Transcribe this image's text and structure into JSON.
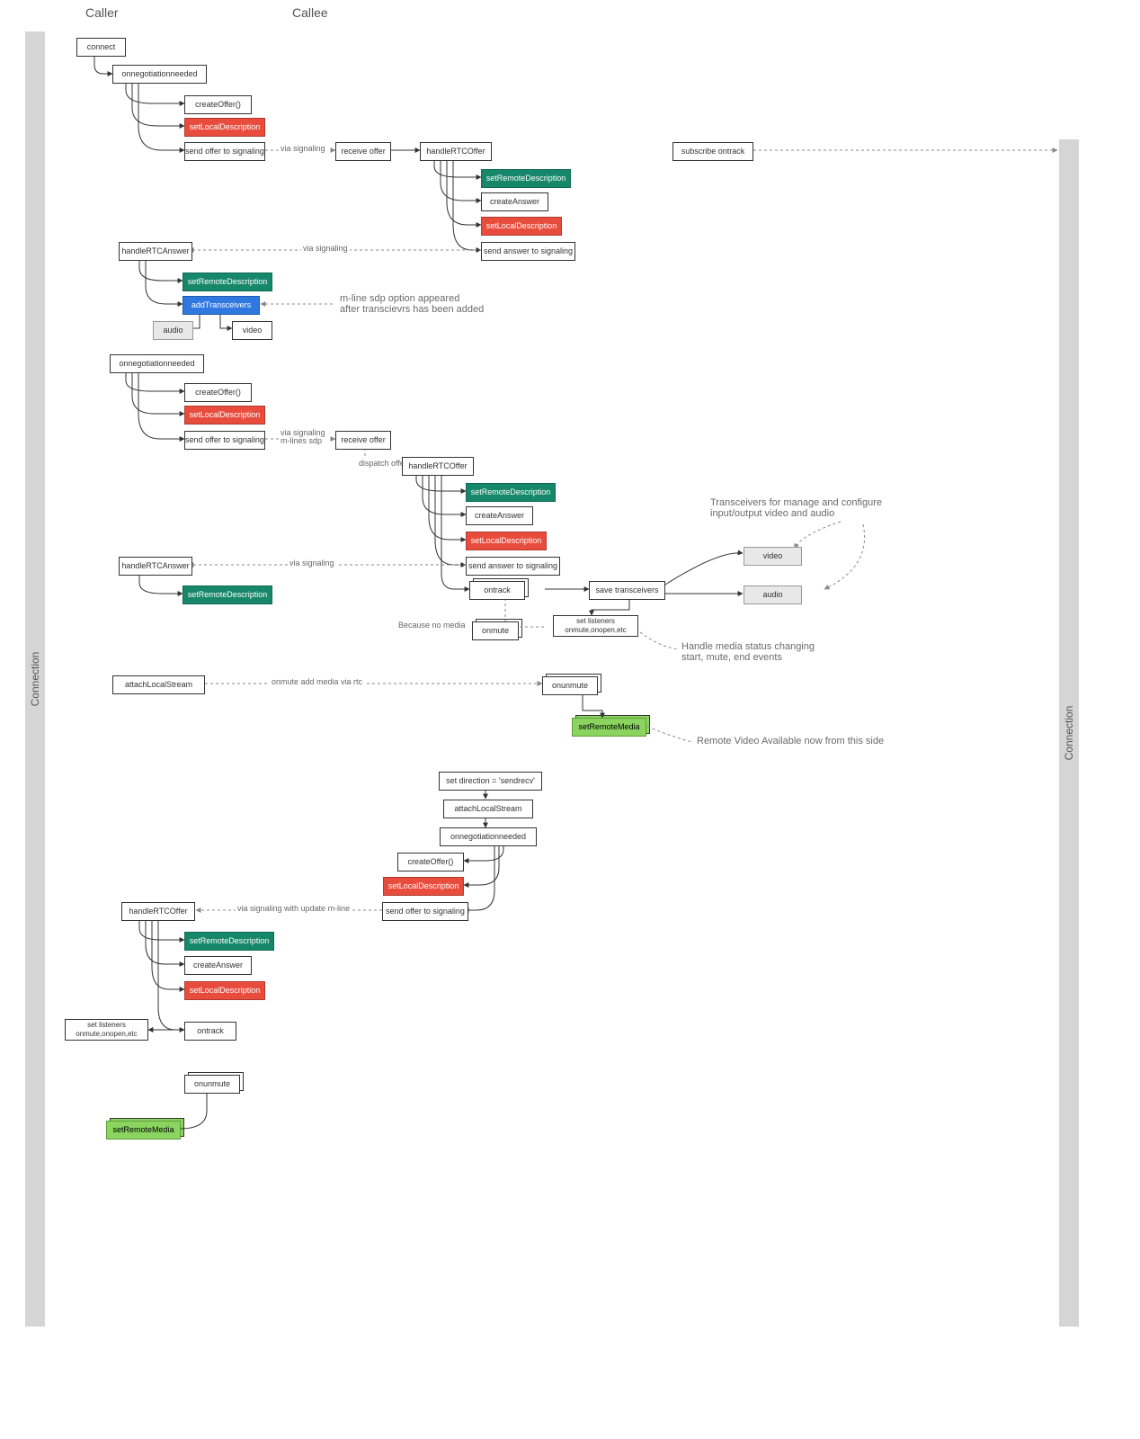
{
  "headers": {
    "caller": "Caller",
    "callee": "Callee"
  },
  "lanes": {
    "left": "Connection",
    "right": "Connection"
  },
  "nodes": {
    "connect": "connect",
    "onneg1": "onnegotiationneeded",
    "createOffer1": "createOffer()",
    "setLocal1": "setLocalDescription",
    "sendOffer1": "send offer to signaling",
    "recvOffer1": "receive offer",
    "handleOffer1": "handleRTCOffer",
    "subscribe": "subscribe ontrack",
    "setRemote1": "setRemoteDescription",
    "createAnswer1": "createAnswer",
    "setLocal2": "setLocalDescription",
    "sendAnswer1": "send answer to signaling",
    "handleAnswer1": "handleRTCAnswer",
    "setRemote2": "setRemoteDescription",
    "addTrans": "addTransceivers",
    "audio1": "audio",
    "video1": "video",
    "onneg2": "onnegotiationneeded",
    "createOffer2": "createOffer()",
    "setLocal3": "setLocalDescription",
    "sendOffer2": "send offer to signaling",
    "recvOffer2": "receive offer",
    "handleOffer2": "handleRTCOffer",
    "setRemote3": "setRemoteDescription",
    "createAnswer2": "createAnswer",
    "setLocal4": "setLocalDescription",
    "sendAnswer2": "send answer to signaling",
    "handleAnswer2": "handleRTCAnswer",
    "setRemote4": "setRemoteDescription",
    "ontrack1": "ontrack",
    "saveTrans": "save transceivers",
    "videoT": "video",
    "audioT": "audio",
    "setListeners1": "set listeners\nonmute,onopen,etc",
    "onmute": "onmute",
    "attachLocal1": "attachLocalStream",
    "onunmute1": "onunmute",
    "setRemoteMedia1": "setRemoteMedia",
    "setDir": "set direction = 'sendrecv'",
    "attachLocal2": "attachLocalStream",
    "onneg3": "onnegotiationneeded",
    "createOffer3": "createOffer()",
    "setLocal5": "setLocalDescription",
    "sendOffer3": "send offer to signaling",
    "handleOffer3": "handleRTCOffer",
    "setRemote5": "setRemoteDescription",
    "createAnswer3": "createAnswer",
    "setLocal6": "setLocalDescription",
    "ontrack2": "ontrack",
    "setListeners2": "set listeners\nonmute,onopen,etc",
    "onunmute2": "onunmute",
    "setRemoteMedia2": "setRemoteMedia"
  },
  "edgeLabels": {
    "viaSig1": "via signaling",
    "viaSig2": "via signaling",
    "viaSigMline": "via signaling\nm-lines sdp",
    "dispatch": "dispatch offer",
    "viaSig3": "via signaling",
    "onmuteAdd": "onmute add media via rtc",
    "noMedia": "Because no media",
    "viaSigUpdate": "via signaling with update m-line"
  },
  "annotations": {
    "mline": "m-line sdp option appeared\nafter transcievrs has been added",
    "transceivers": "Transceivers for manage and configure\ninput/output video and audio",
    "handleMedia": "Handle media status changing\nstart, mute, end events",
    "remoteVideo": "Remote Video Available now from this side"
  }
}
